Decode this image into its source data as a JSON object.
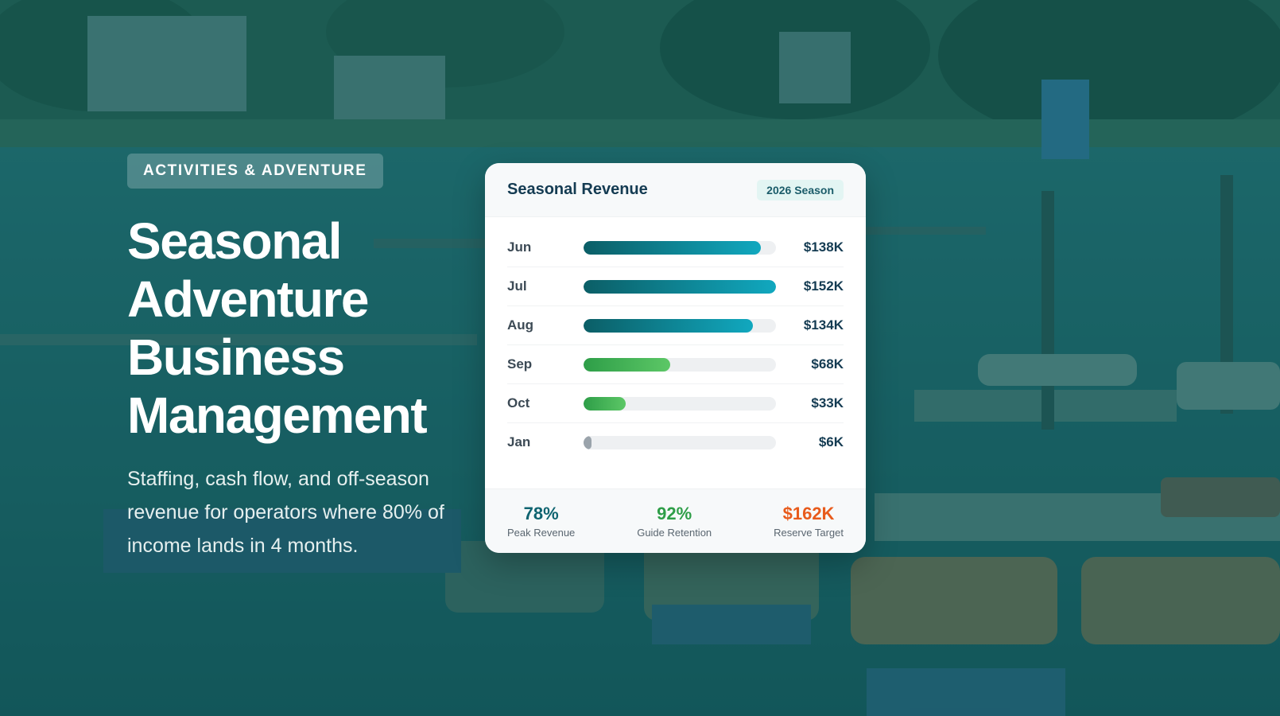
{
  "hero": {
    "category_badge": "ACTIVITIES & ADVENTURE",
    "headline_lines": [
      "Seasonal",
      "Adventure",
      "Business",
      "Management"
    ],
    "subtitle": "Staffing, cash flow, and off-season revenue for operators where 80% of income lands in 4 months."
  },
  "card": {
    "title": "Seasonal Revenue",
    "season_tag": "2026 Season",
    "rows": [
      {
        "month": "Jun",
        "value": "$138K",
        "fraction": 0.92,
        "color": "teal"
      },
      {
        "month": "Jul",
        "value": "$152K",
        "fraction": 1.0,
        "color": "teal"
      },
      {
        "month": "Aug",
        "value": "$134K",
        "fraction": 0.88,
        "color": "teal"
      },
      {
        "month": "Sep",
        "value": "$68K",
        "fraction": 0.45,
        "color": "green"
      },
      {
        "month": "Oct",
        "value": "$33K",
        "fraction": 0.22,
        "color": "green"
      },
      {
        "month": "Jan",
        "value": "$6K",
        "fraction": 0.04,
        "color": "gray"
      }
    ],
    "stats": [
      {
        "value": "78%",
        "label": "Peak Revenue",
        "color": "#0f6470"
      },
      {
        "value": "92%",
        "label": "Guide Retention",
        "color": "#2e9e48"
      },
      {
        "value": "$162K",
        "label": "Reserve Target",
        "color": "#e85b1c"
      }
    ]
  },
  "colors": {
    "teal_gradient": [
      "#0b5e66",
      "#11a8bf"
    ],
    "green_gradient": [
      "#2e9e48",
      "#5cc766"
    ],
    "gray": "#9aa3ab",
    "overlay": "#105c5c"
  }
}
